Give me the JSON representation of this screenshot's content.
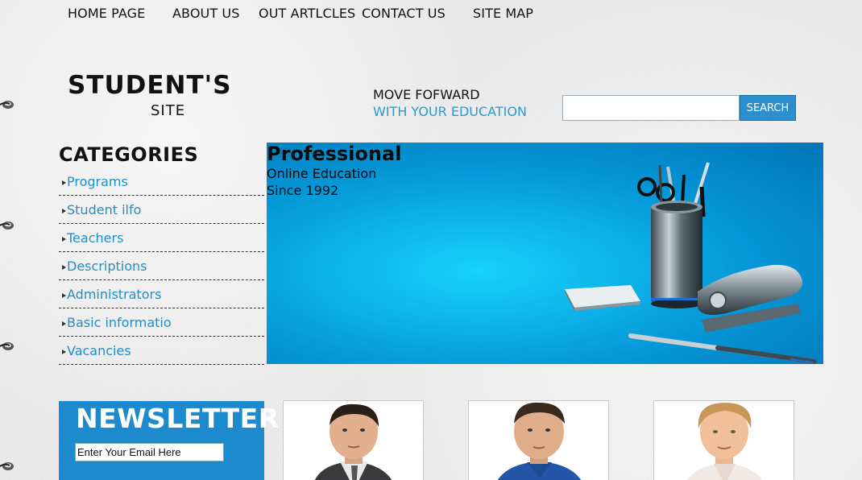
{
  "nav": {
    "items": [
      "HOME PAGE",
      "ABOUT US",
      "OUT ARTLCLES",
      "CONTACT US",
      "SITE MAP"
    ]
  },
  "logo": {
    "title": "STUDENT'S",
    "subtitle": "SITE"
  },
  "tagline": {
    "line1": "MOVE FOFWARD",
    "line2": "WITH YOUR EDUCATION"
  },
  "search": {
    "placeholder": "",
    "value": "",
    "button_label": "SEARCH"
  },
  "categories": {
    "title": "CATEGORIES",
    "items": [
      "Programs",
      "Student ilfo",
      "Teachers",
      "Descriptions",
      "Administrators",
      "Basic informatio",
      "Vacancies"
    ]
  },
  "banner": {
    "heading": "Professional",
    "line1": "Online Education",
    "line2": "Since 1992"
  },
  "newsletter": {
    "title": "NEWSLETTER",
    "placeholder": "Enter Your Email Here"
  },
  "colors": {
    "accent_blue": "#1c8acd",
    "link_blue": "#1f8fc9",
    "tagline_blue": "#2a9ad3"
  },
  "icons": [
    "spiral-ring-icon",
    "bullet-arrow-icon"
  ]
}
